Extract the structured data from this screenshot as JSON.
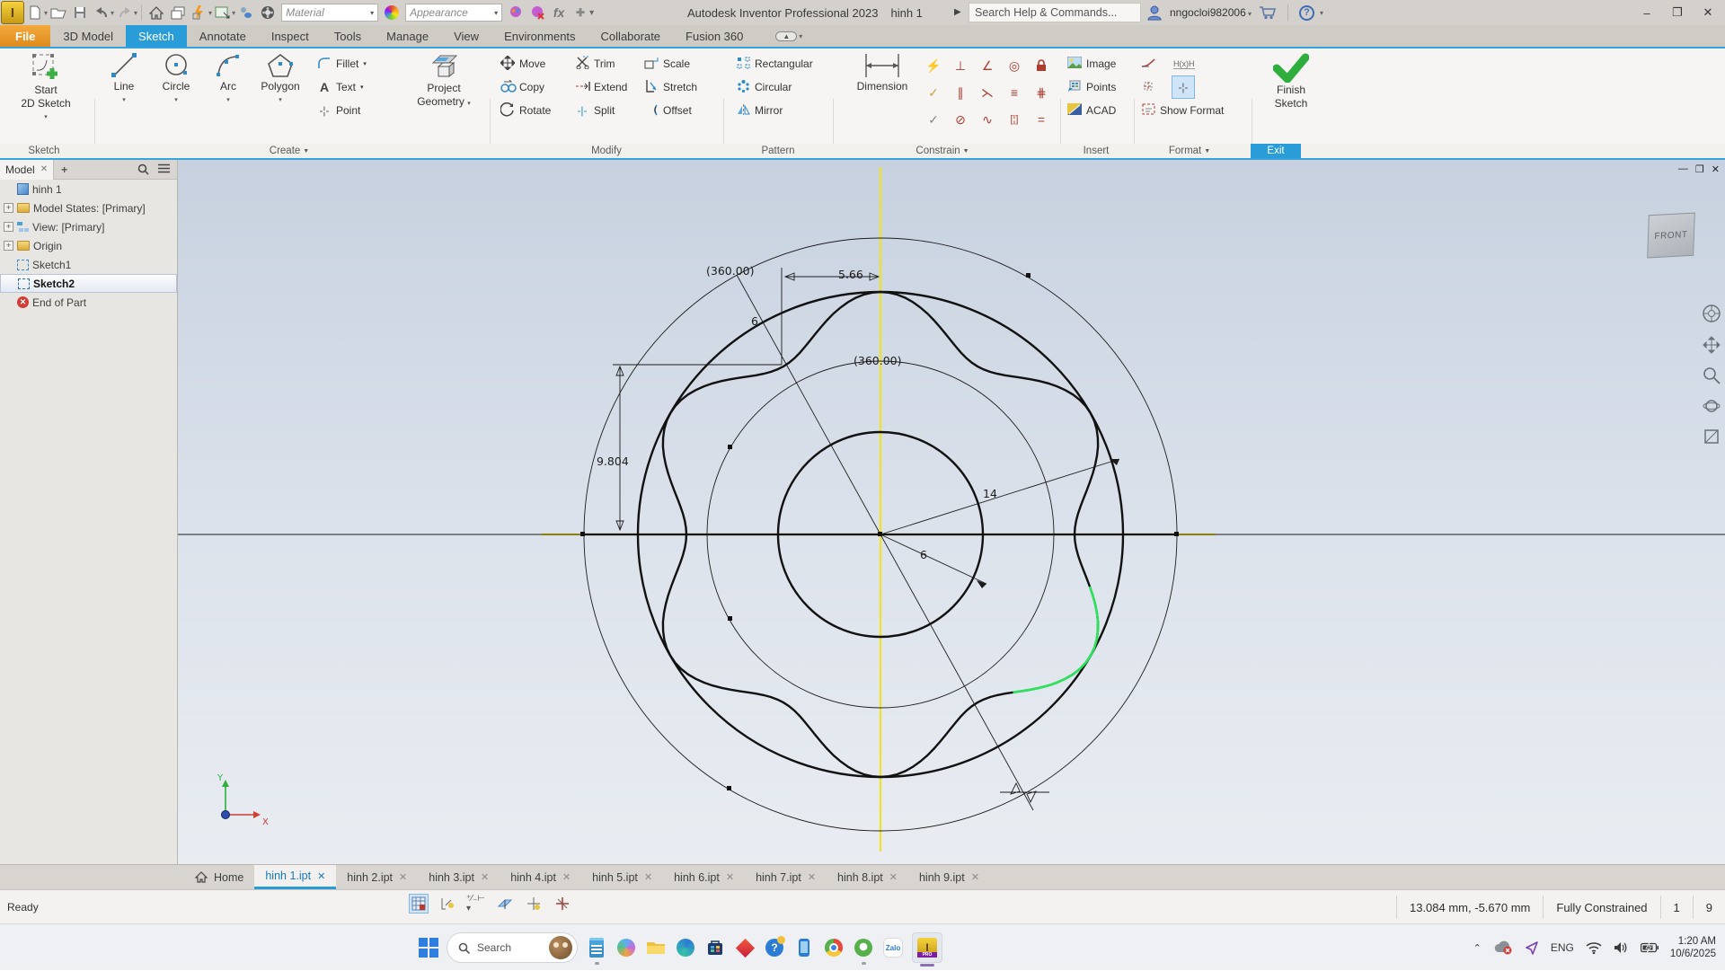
{
  "titlebar": {
    "app_initial": "I",
    "material_value": "Material",
    "appearance_value": "Appearance",
    "title": "Autodesk Inventor Professional 2023",
    "doc_name": "hinh 1",
    "search_placeholder": "Search Help & Commands...",
    "username": "nngocloi982006",
    "minimize": "–",
    "restore": "❐",
    "close": "✕"
  },
  "ribbon": {
    "tabs": [
      {
        "label": "File"
      },
      {
        "label": "3D Model"
      },
      {
        "label": "Sketch"
      },
      {
        "label": "Annotate"
      },
      {
        "label": "Inspect"
      },
      {
        "label": "Tools"
      },
      {
        "label": "Manage"
      },
      {
        "label": "View"
      },
      {
        "label": "Environments"
      },
      {
        "label": "Collaborate"
      },
      {
        "label": "Fusion 360"
      }
    ],
    "sketch_panel": {
      "label": "Sketch",
      "start1": "Start",
      "start2": "2D Sketch"
    },
    "create": {
      "label": "Create",
      "line": "Line",
      "circle": "Circle",
      "arc": "Arc",
      "polygon": "Polygon",
      "fillet": "Fillet",
      "text": "Text",
      "point": "Point",
      "project1": "Project",
      "project2": "Geometry"
    },
    "modify": {
      "label": "Modify",
      "move": "Move",
      "copy": "Copy",
      "rotate": "Rotate",
      "trim": "Trim",
      "extend": "Extend",
      "split": "Split",
      "scale": "Scale",
      "stretch": "Stretch",
      "offset": "Offset"
    },
    "pattern": {
      "label": "Pattern",
      "rectangular": "Rectangular",
      "circular": "Circular",
      "mirror": "Mirror"
    },
    "constrain": {
      "label": "Constrain",
      "dimension": "Dimension"
    },
    "insert": {
      "label": "Insert",
      "image": "Image",
      "points": "Points",
      "acad": "ACAD"
    },
    "format": {
      "label": "Format",
      "hxh": "H(x)H",
      "show_format": "Show Format"
    },
    "exit": {
      "label": "Exit",
      "finish1": "Finish",
      "finish2": "Sketch"
    }
  },
  "browser": {
    "tab": "Model",
    "tree": [
      {
        "label": "hinh 1"
      },
      {
        "label": "Model States: [Primary]"
      },
      {
        "label": "View: [Primary]"
      },
      {
        "label": "Origin"
      },
      {
        "label": "Sketch1"
      },
      {
        "label": "Sketch2"
      },
      {
        "label": "End of Part"
      }
    ]
  },
  "canvas": {
    "viewcube": "FRONT",
    "dims": {
      "d360_top": "(360.00)",
      "d566": "5.66",
      "d6_top": "6",
      "d360_mid": "(360.00)",
      "d9804": "9.804",
      "d14": "14",
      "d6_right": "6"
    },
    "axis_color": "#efe32a",
    "highlight_color": "#2de35c"
  },
  "doc_tabs": {
    "home": "Home",
    "close_glyph": "✕",
    "tabs": [
      {
        "label": "hinh 1.ipt"
      },
      {
        "label": "hinh 2.ipt"
      },
      {
        "label": "hinh 3.ipt"
      },
      {
        "label": "hinh 4.ipt"
      },
      {
        "label": "hinh 5.ipt"
      },
      {
        "label": "hinh 6.ipt"
      },
      {
        "label": "hinh 7.ipt"
      },
      {
        "label": "hinh 8.ipt"
      },
      {
        "label": "hinh 9.ipt"
      }
    ]
  },
  "statusbar": {
    "ready": "Ready",
    "coords": "13.084 mm, -5.670 mm",
    "constraint_status": "Fully Constrained",
    "dim_count": "1",
    "doc_count": "9"
  },
  "taskbar": {
    "search_placeholder": "Search",
    "zalo_label": "Zalo",
    "inventor_letter": "I",
    "inventor_pro": "PRO",
    "lang": "ENG",
    "time": "1:20 AM",
    "date": "10/6/2025"
  }
}
